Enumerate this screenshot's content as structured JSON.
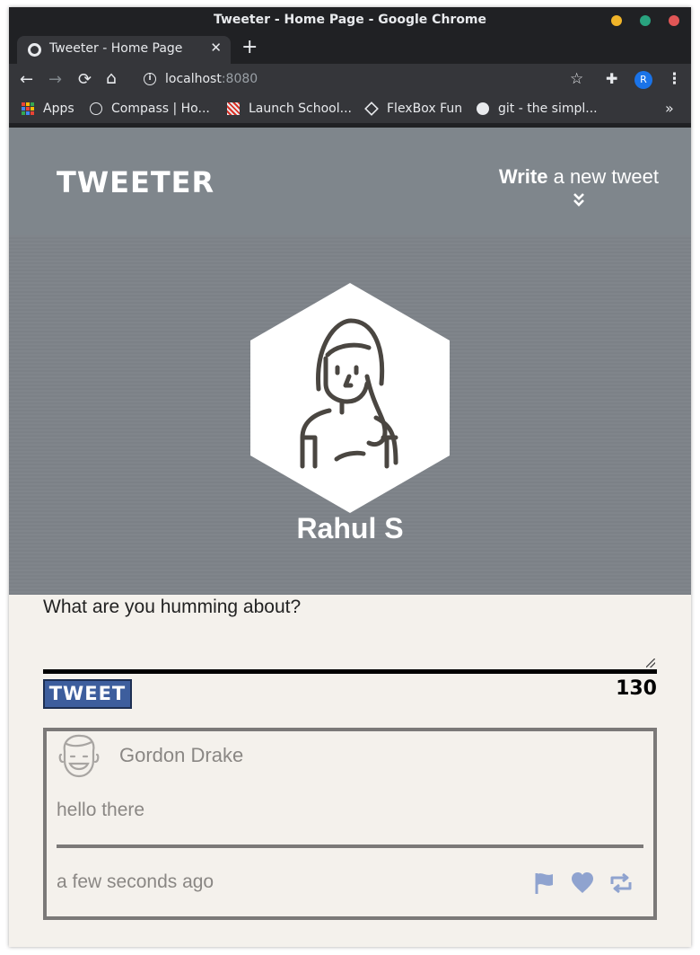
{
  "window": {
    "title": "Tweeter - Home Page - Google Chrome"
  },
  "tab": {
    "title": "Tweeter - Home Page",
    "close": "✕",
    "new": "+"
  },
  "toolbar": {
    "url_host": "localhost",
    "url_port": ":8080",
    "profile_initial": "R"
  },
  "bookmarks": [
    {
      "label": "Apps"
    },
    {
      "label": "Compass | Ho..."
    },
    {
      "label": "Launch School..."
    },
    {
      "label": "FlexBox Fun"
    },
    {
      "label": "git - the simpl..."
    }
  ],
  "bookmarks_more": "»",
  "site": {
    "logo": "TWEETER",
    "compose_bold": "Write",
    "compose_rest": " a new tweet",
    "compose_arrow": "⌄"
  },
  "profile": {
    "name": "Rahul S"
  },
  "new_tweet": {
    "placeholder": "What are you humming about?",
    "button": "TWEET",
    "counter": "130"
  },
  "tweets": [
    {
      "author": "Gordon Drake",
      "text": "hello there",
      "time": "a few seconds ago",
      "actions": [
        "flag-icon",
        "heart-icon",
        "retweet-icon"
      ]
    }
  ],
  "colors": {
    "header_bg": "#7f868c",
    "page_bg": "#f4f1ec",
    "tweet_button": "#3d5e9d",
    "action_icons": "#8fa3cf"
  }
}
